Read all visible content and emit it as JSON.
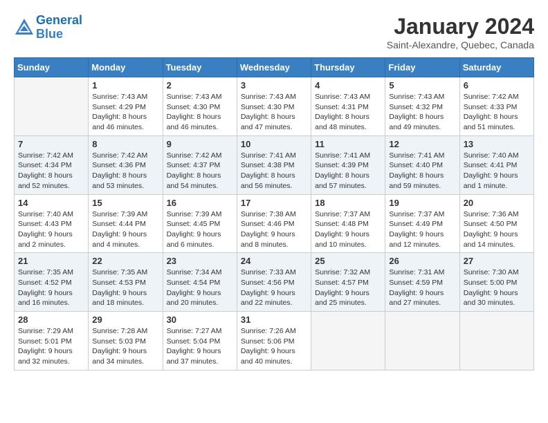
{
  "header": {
    "logo_line1": "General",
    "logo_line2": "Blue",
    "month": "January 2024",
    "location": "Saint-Alexandre, Quebec, Canada"
  },
  "weekdays": [
    "Sunday",
    "Monday",
    "Tuesday",
    "Wednesday",
    "Thursday",
    "Friday",
    "Saturday"
  ],
  "weeks": [
    [
      {
        "num": "",
        "info": ""
      },
      {
        "num": "1",
        "info": "Sunrise: 7:43 AM\nSunset: 4:29 PM\nDaylight: 8 hours\nand 46 minutes."
      },
      {
        "num": "2",
        "info": "Sunrise: 7:43 AM\nSunset: 4:30 PM\nDaylight: 8 hours\nand 46 minutes."
      },
      {
        "num": "3",
        "info": "Sunrise: 7:43 AM\nSunset: 4:30 PM\nDaylight: 8 hours\nand 47 minutes."
      },
      {
        "num": "4",
        "info": "Sunrise: 7:43 AM\nSunset: 4:31 PM\nDaylight: 8 hours\nand 48 minutes."
      },
      {
        "num": "5",
        "info": "Sunrise: 7:43 AM\nSunset: 4:32 PM\nDaylight: 8 hours\nand 49 minutes."
      },
      {
        "num": "6",
        "info": "Sunrise: 7:42 AM\nSunset: 4:33 PM\nDaylight: 8 hours\nand 51 minutes."
      }
    ],
    [
      {
        "num": "7",
        "info": "Sunrise: 7:42 AM\nSunset: 4:34 PM\nDaylight: 8 hours\nand 52 minutes."
      },
      {
        "num": "8",
        "info": "Sunrise: 7:42 AM\nSunset: 4:36 PM\nDaylight: 8 hours\nand 53 minutes."
      },
      {
        "num": "9",
        "info": "Sunrise: 7:42 AM\nSunset: 4:37 PM\nDaylight: 8 hours\nand 54 minutes."
      },
      {
        "num": "10",
        "info": "Sunrise: 7:41 AM\nSunset: 4:38 PM\nDaylight: 8 hours\nand 56 minutes."
      },
      {
        "num": "11",
        "info": "Sunrise: 7:41 AM\nSunset: 4:39 PM\nDaylight: 8 hours\nand 57 minutes."
      },
      {
        "num": "12",
        "info": "Sunrise: 7:41 AM\nSunset: 4:40 PM\nDaylight: 8 hours\nand 59 minutes."
      },
      {
        "num": "13",
        "info": "Sunrise: 7:40 AM\nSunset: 4:41 PM\nDaylight: 9 hours\nand 1 minute."
      }
    ],
    [
      {
        "num": "14",
        "info": "Sunrise: 7:40 AM\nSunset: 4:43 PM\nDaylight: 9 hours\nand 2 minutes."
      },
      {
        "num": "15",
        "info": "Sunrise: 7:39 AM\nSunset: 4:44 PM\nDaylight: 9 hours\nand 4 minutes."
      },
      {
        "num": "16",
        "info": "Sunrise: 7:39 AM\nSunset: 4:45 PM\nDaylight: 9 hours\nand 6 minutes."
      },
      {
        "num": "17",
        "info": "Sunrise: 7:38 AM\nSunset: 4:46 PM\nDaylight: 9 hours\nand 8 minutes."
      },
      {
        "num": "18",
        "info": "Sunrise: 7:37 AM\nSunset: 4:48 PM\nDaylight: 9 hours\nand 10 minutes."
      },
      {
        "num": "19",
        "info": "Sunrise: 7:37 AM\nSunset: 4:49 PM\nDaylight: 9 hours\nand 12 minutes."
      },
      {
        "num": "20",
        "info": "Sunrise: 7:36 AM\nSunset: 4:50 PM\nDaylight: 9 hours\nand 14 minutes."
      }
    ],
    [
      {
        "num": "21",
        "info": "Sunrise: 7:35 AM\nSunset: 4:52 PM\nDaylight: 9 hours\nand 16 minutes."
      },
      {
        "num": "22",
        "info": "Sunrise: 7:35 AM\nSunset: 4:53 PM\nDaylight: 9 hours\nand 18 minutes."
      },
      {
        "num": "23",
        "info": "Sunrise: 7:34 AM\nSunset: 4:54 PM\nDaylight: 9 hours\nand 20 minutes."
      },
      {
        "num": "24",
        "info": "Sunrise: 7:33 AM\nSunset: 4:56 PM\nDaylight: 9 hours\nand 22 minutes."
      },
      {
        "num": "25",
        "info": "Sunrise: 7:32 AM\nSunset: 4:57 PM\nDaylight: 9 hours\nand 25 minutes."
      },
      {
        "num": "26",
        "info": "Sunrise: 7:31 AM\nSunset: 4:59 PM\nDaylight: 9 hours\nand 27 minutes."
      },
      {
        "num": "27",
        "info": "Sunrise: 7:30 AM\nSunset: 5:00 PM\nDaylight: 9 hours\nand 30 minutes."
      }
    ],
    [
      {
        "num": "28",
        "info": "Sunrise: 7:29 AM\nSunset: 5:01 PM\nDaylight: 9 hours\nand 32 minutes."
      },
      {
        "num": "29",
        "info": "Sunrise: 7:28 AM\nSunset: 5:03 PM\nDaylight: 9 hours\nand 34 minutes."
      },
      {
        "num": "30",
        "info": "Sunrise: 7:27 AM\nSunset: 5:04 PM\nDaylight: 9 hours\nand 37 minutes."
      },
      {
        "num": "31",
        "info": "Sunrise: 7:26 AM\nSunset: 5:06 PM\nDaylight: 9 hours\nand 40 minutes."
      },
      {
        "num": "",
        "info": ""
      },
      {
        "num": "",
        "info": ""
      },
      {
        "num": "",
        "info": ""
      }
    ]
  ]
}
